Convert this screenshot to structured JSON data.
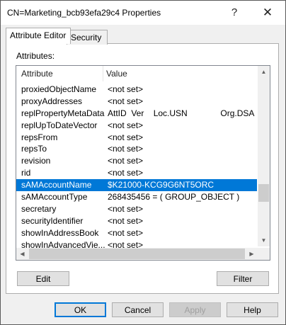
{
  "window": {
    "title": "CN=Marketing_bcb93efa29c4 Properties",
    "help_glyph": "?",
    "close_glyph": "✕"
  },
  "tabs": [
    {
      "label": "Attribute Editor",
      "active": true
    },
    {
      "label": "Security",
      "active": false
    }
  ],
  "attributes_label": "Attributes:",
  "columns": {
    "attribute": "Attribute",
    "value": "Value"
  },
  "rows": [
    {
      "name": "proxiedObjectName",
      "value": "<not set>"
    },
    {
      "name": "proxyAddresses",
      "value": "<not set>"
    },
    {
      "name": "replPropertyMetaData",
      "value": "AttID  Ver    Loc.USN              Org.DSA"
    },
    {
      "name": "replUpToDateVector",
      "value": "<not set>"
    },
    {
      "name": "repsFrom",
      "value": "<not set>"
    },
    {
      "name": "repsTo",
      "value": "<not set>"
    },
    {
      "name": "revision",
      "value": "<not set>"
    },
    {
      "name": "rid",
      "value": "<not set>"
    },
    {
      "name": "sAMAccountName",
      "value": "$K21000-KCG9G6NT5ORC",
      "selected": true
    },
    {
      "name": "sAMAccountType",
      "value": "268435456 = ( GROUP_OBJECT )"
    },
    {
      "name": "secretary",
      "value": "<not set>"
    },
    {
      "name": "securityIdentifier",
      "value": "<not set>"
    },
    {
      "name": "showInAddressBook",
      "value": "<not set>"
    },
    {
      "name": "showInAdvancedVie...",
      "value": "<not set>"
    }
  ],
  "buttons": {
    "edit": "Edit",
    "filter": "Filter",
    "ok": "OK",
    "cancel": "Cancel",
    "apply": "Apply",
    "help": "Help"
  },
  "icons": {
    "scroll_up": "▲",
    "scroll_down": "▼",
    "scroll_left": "◀",
    "scroll_right": "▶"
  },
  "colors": {
    "selection": "#0078d7",
    "default_button_border": "#0078d7"
  }
}
